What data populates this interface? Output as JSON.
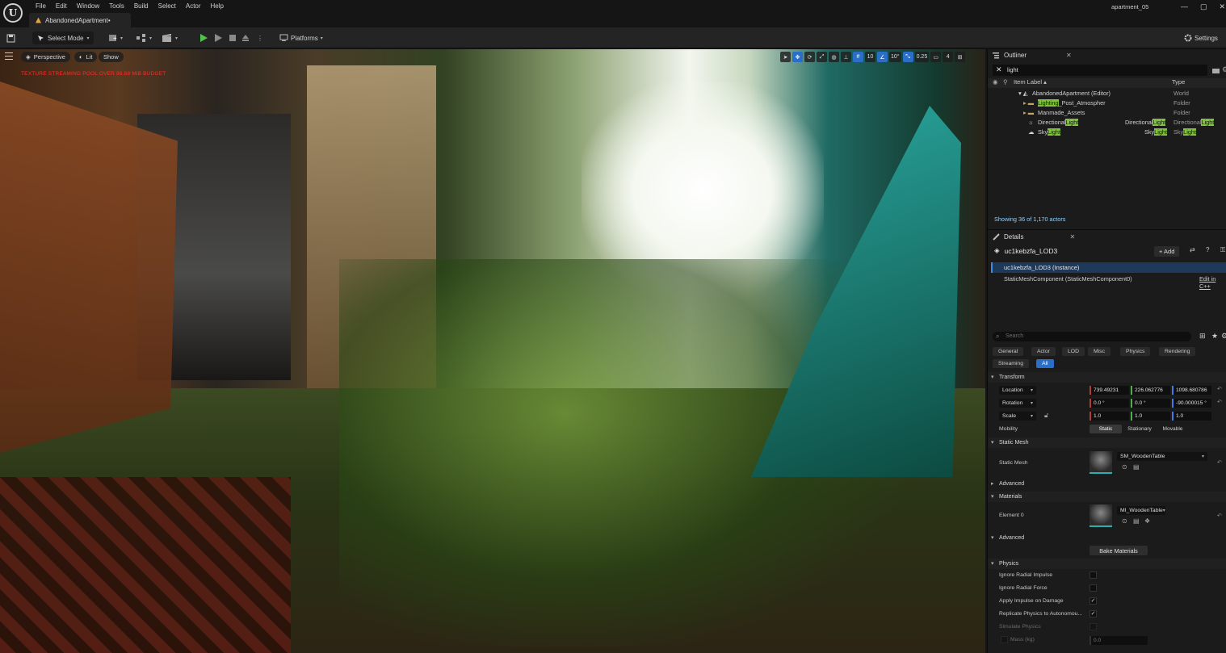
{
  "app": {
    "menus": [
      "File",
      "Edit",
      "Window",
      "Tools",
      "Build",
      "Select",
      "Actor",
      "Help"
    ],
    "document_tab": "AbandonedApartment•",
    "project_name": "apartment_05",
    "window_controls": [
      "—",
      "▢",
      "✕"
    ]
  },
  "toolbar": {
    "select_mode": "Select Mode",
    "platforms": "Platforms",
    "settings": "Settings"
  },
  "viewport": {
    "perspective": "Perspective",
    "lit": "Lit",
    "show": "Show",
    "warning": "TEXTURE STREAMING POOL OVER 86.88 MiB BUDGET",
    "grid_snap": "10",
    "rotation_snap": "10°",
    "scale_snap": "0.25",
    "camera_speed": "4"
  },
  "outliner": {
    "tab": "Outliner",
    "search_value": "light",
    "col_label": "Item Label ▴",
    "col_type": "Type",
    "rows": [
      {
        "indent": 1,
        "label": "AbandonedApartment (Editor)",
        "mid": "",
        "type": "World"
      },
      {
        "indent": 2,
        "label": "Lighting_Post_Atmospher",
        "mid": "",
        "type": "Folder"
      },
      {
        "indent": 2,
        "label": "Manmade_Assets",
        "mid": "",
        "type": "Folder"
      },
      {
        "indent": 2,
        "label": "DirectionalLight",
        "mid": "DirectionalLight",
        "type": "DirectionalLight"
      },
      {
        "indent": 2,
        "label": "SkyLight",
        "mid": "SkyLight",
        "type": "SkyLight"
      }
    ],
    "status": "Showing 36 of 1,170 actors"
  },
  "details": {
    "tab": "Details",
    "actor_name": "uc1kebzfa_LOD3",
    "add_label": "+ Add",
    "component_root": "uc1kebzfa_LOD3 (Instance)",
    "component_child": "StaticMeshComponent (StaticMeshComponent0)",
    "edit_cpp": "Edit in C++",
    "search_placeholder": "Search",
    "categories": [
      "General",
      "Actor",
      "LOD",
      "Misc",
      "Physics",
      "Rendering",
      "Streaming",
      "All"
    ],
    "sections": {
      "transform": "Transform",
      "static_mesh": "Static Mesh",
      "advanced": "Advanced",
      "materials": "Materials",
      "advanced2": "Advanced",
      "physics": "Physics"
    },
    "transform": {
      "location_label": "Location",
      "rotation_label": "Rotation",
      "scale_label": "Scale",
      "location": [
        "739.49231",
        "226.062776",
        "1098.680786"
      ],
      "rotation": [
        "0.0 °",
        "0.0 °",
        "-90.000015 °"
      ],
      "scale": [
        "1.0",
        "1.0",
        "1.0"
      ],
      "mobility_label": "Mobility",
      "mobility_options": [
        "Static",
        "Stationary",
        "Movable"
      ]
    },
    "static_mesh": {
      "label": "Static Mesh",
      "value": "SM_WoodenTable"
    },
    "materials": {
      "label": "Element 0",
      "value": "MI_WoodenTable"
    },
    "bake_materials": "Bake Materials",
    "physics": [
      {
        "label": "Ignore Radial Impulse",
        "checked": false
      },
      {
        "label": "Ignore Radial Force",
        "checked": false
      },
      {
        "label": "Apply Impulse on Damage",
        "checked": true
      },
      {
        "label": "Replicate Physics to Autonomou...",
        "checked": true
      },
      {
        "label": "Simulate Physics",
        "checked": false
      },
      {
        "label": "Mass (kg)",
        "checked": false
      }
    ],
    "mass_value": "0.0"
  }
}
